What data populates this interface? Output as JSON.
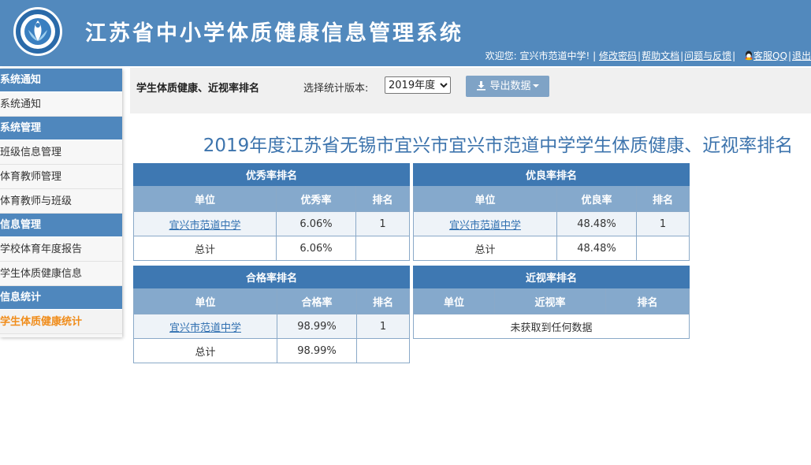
{
  "header": {
    "site_title": "江苏省中小学体质健康信息管理系统",
    "welcome": "欢迎您: 宜兴市范道中学! |",
    "links": {
      "change_password": "修改密码",
      "help": "帮助文档",
      "feedback": "问题与反馈",
      "qq_service": "客服QQ",
      "logout": "退出"
    }
  },
  "sidebar": {
    "groups": [
      {
        "title": "系统通知",
        "items": [
          "系统通知"
        ]
      },
      {
        "title": "系统管理",
        "items": [
          "班级信息管理",
          "体育教师管理",
          "体育教师与班级"
        ]
      },
      {
        "title": "信息管理",
        "items": [
          "学校体育年度报告",
          "学生体质健康信息"
        ]
      },
      {
        "title": "信息统计",
        "items": [
          "学生体质健康统计"
        ]
      }
    ],
    "active_item": "学生体质健康统计"
  },
  "toolbar": {
    "page_name": "学生体质健康、近视率排名",
    "version_label": "选择统计版本:",
    "version_selected": "2019年度",
    "export_label": "导出数据"
  },
  "report": {
    "title": "2019年度江苏省无锡市宜兴市宜兴市范道中学学生体质健康、近视率排名"
  },
  "tables": {
    "excellent": {
      "caption": "优秀率排名",
      "headers": [
        "单位",
        "优秀率",
        "排名"
      ],
      "rows": [
        {
          "unit": "宜兴市范道中学",
          "rate": "6.06%",
          "rank": "1"
        },
        {
          "unit": "总计",
          "rate": "6.06%",
          "rank": ""
        }
      ]
    },
    "good": {
      "caption": "优良率排名",
      "headers": [
        "单位",
        "优良率",
        "排名"
      ],
      "rows": [
        {
          "unit": "宜兴市范道中学",
          "rate": "48.48%",
          "rank": "1"
        },
        {
          "unit": "总计",
          "rate": "48.48%",
          "rank": ""
        }
      ]
    },
    "pass": {
      "caption": "合格率排名",
      "headers": [
        "单位",
        "合格率",
        "排名"
      ],
      "rows": [
        {
          "unit": "宜兴市范道中学",
          "rate": "98.99%",
          "rank": "1"
        },
        {
          "unit": "总计",
          "rate": "98.99%",
          "rank": ""
        }
      ]
    },
    "myopia": {
      "caption": "近视率排名",
      "headers": [
        "单位",
        "近视率",
        "排名"
      ],
      "empty_text": "未获取到任何数据"
    }
  },
  "colors": {
    "header_bg": "#5289bd",
    "nav_head_bg": "#4f87bd",
    "table_caption_bg": "#3e78b2",
    "table_header_bg": "#85a9cc",
    "active_nav": "#f08c1a",
    "title_text": "#3d74ad"
  }
}
